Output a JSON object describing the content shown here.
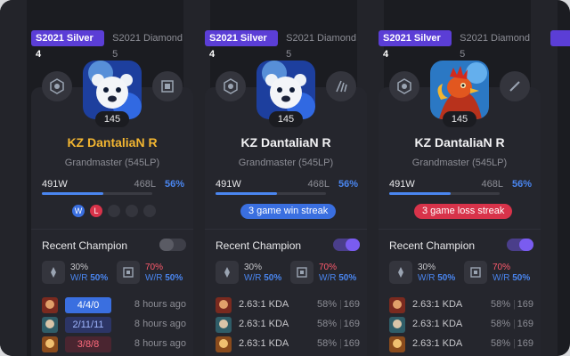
{
  "colors": {
    "accent": "#5b3ed6",
    "win": "#3a6fe0",
    "loss": "#d8334a",
    "gold": "#f2b531",
    "winrate": "#4a86f0"
  },
  "cards": [
    {
      "tabs": [
        "S2021 Silver 4",
        "S2021 Diamond 5"
      ],
      "level": "145",
      "name": "KZ DantaliaN R",
      "name_gold": true,
      "rank": "Grandmaster (545LP)",
      "wins": "491W",
      "losses": "468L",
      "winrate": "56%",
      "winrate_fraction": 0.56,
      "recent_results": [
        "W",
        "L",
        "",
        "",
        ""
      ],
      "streak": null,
      "recent_champion_label": "Recent Champion",
      "toggle_on": false,
      "stat1": {
        "pct": "30%",
        "wr_label": "W/R",
        "wr": "50%"
      },
      "stat2": {
        "pct": "70%",
        "wr_label": "W/R",
        "wr": "50%"
      },
      "games": [
        {
          "kda": "4/4/0",
          "style": "win1",
          "ago": "8 hours ago"
        },
        {
          "kda": "2/11/11",
          "style": "win2",
          "ago": "8 hours ago"
        },
        {
          "kda": "3/8/8",
          "style": "loss",
          "ago": "8 hours ago"
        }
      ]
    },
    {
      "tabs": [
        "S2021 Silver 4",
        "S2021 Diamond 5"
      ],
      "level": "145",
      "name": "KZ DantaliaN R",
      "name_gold": false,
      "rank": "Grandmaster (545LP)",
      "wins": "491W",
      "losses": "468L",
      "winrate": "56%",
      "winrate_fraction": 0.56,
      "streak": {
        "text": "3 game win streak",
        "type": "win"
      },
      "recent_champion_label": "Recent Champion",
      "toggle_on": true,
      "stat1": {
        "pct": "30%",
        "wr_label": "W/R",
        "wr": "50%"
      },
      "stat2": {
        "pct": "70%",
        "wr_label": "W/R",
        "wr": "50%"
      },
      "champs": [
        {
          "kda": "2.63:1 KDA",
          "wr": "58%",
          "games": "169"
        },
        {
          "kda": "2.63:1 KDA",
          "wr": "58%",
          "games": "169"
        },
        {
          "kda": "2.63:1 KDA",
          "wr": "58%",
          "games": "169"
        }
      ]
    },
    {
      "tabs": [
        "S2021 Silver 4",
        "S2021 Diamond 5"
      ],
      "level": "145",
      "name": "KZ DantaliaN R",
      "name_gold": false,
      "rank": "Grandmaster (545LP)",
      "wins": "491W",
      "losses": "468L",
      "winrate": "56%",
      "winrate_fraction": 0.56,
      "streak": {
        "text": "3 game loss streak",
        "type": "loss"
      },
      "recent_champion_label": "Recent Champion",
      "toggle_on": true,
      "stat1": {
        "pct": "30%",
        "wr_label": "W/R",
        "wr": "50%"
      },
      "stat2": {
        "pct": "70%",
        "wr_label": "W/R",
        "wr": "50%"
      },
      "champs": [
        {
          "kda": "2.63:1 KDA",
          "wr": "58%",
          "games": "169"
        },
        {
          "kda": "2.63:1 KDA",
          "wr": "58%",
          "games": "169"
        },
        {
          "kda": "2.63:1 KDA",
          "wr": "58%",
          "games": "169"
        }
      ]
    }
  ]
}
